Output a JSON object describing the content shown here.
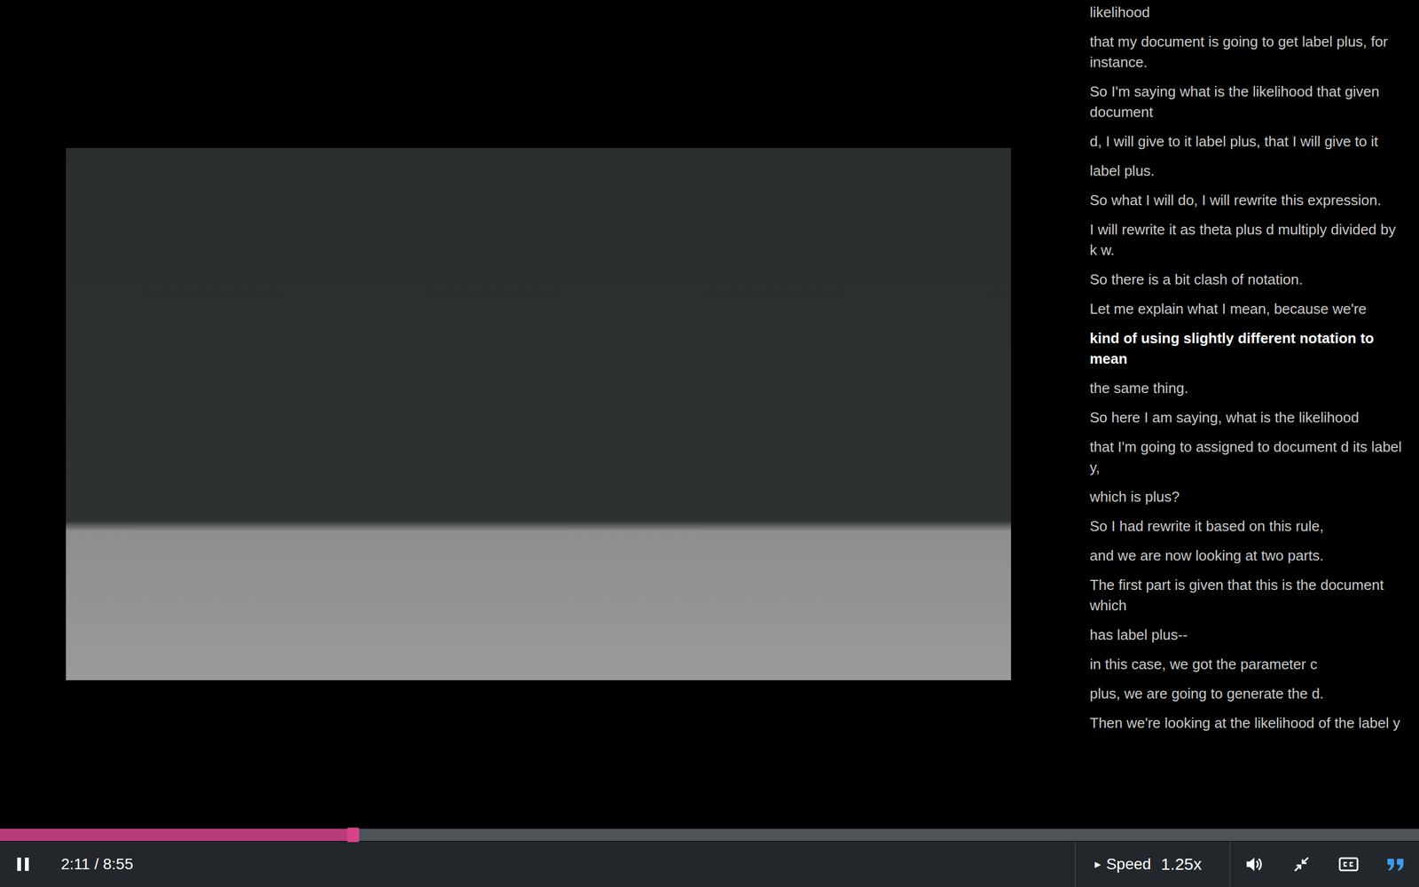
{
  "player": {
    "playing": true,
    "transcript_open": true
  },
  "transcript": [
    {
      "text": "likelihood",
      "selected": false
    },
    {
      "text": "that my document is going to get label plus, for instance.",
      "selected": false
    },
    {
      "text": "So I'm saying what is the likelihood that given document",
      "selected": false
    },
    {
      "text": "d, I will give to it label plus, that I will give to it",
      "selected": false
    },
    {
      "text": "label plus.",
      "selected": false
    },
    {
      "text": "So what I will do, I will rewrite this expression.",
      "selected": false
    },
    {
      "text": "I will rewrite it as theta plus d multiply divided by k w.",
      "selected": false
    },
    {
      "text": "So there is a bit clash of notation.",
      "selected": false
    },
    {
      "text": "Let me explain what I mean, because we're",
      "selected": false
    },
    {
      "text": "kind of using slightly different notation to mean",
      "selected": true
    },
    {
      "text": "the same thing.",
      "selected": false
    },
    {
      "text": "So here I am saying, what is the likelihood",
      "selected": false
    },
    {
      "text": "that I'm going to assigned to document d its label y,",
      "selected": false
    },
    {
      "text": "which is plus?",
      "selected": false
    },
    {
      "text": "So I had rewrite it based on this rule,",
      "selected": false
    },
    {
      "text": "and we are now looking at two parts.",
      "selected": false
    },
    {
      "text": "The first part is given that this is the document which",
      "selected": false
    },
    {
      "text": "has label plus--",
      "selected": false
    },
    {
      "text": "in this case, we got the parameter c",
      "selected": false
    },
    {
      "text": "plus, we are going to generate the d.",
      "selected": false
    },
    {
      "text": "Then we're looking at the likelihood of the label y",
      "selected": false
    }
  ],
  "progress": {
    "level": 0.247
  },
  "controls": {
    "time": "2:11 / 8:55",
    "speed_arrow": "▸",
    "speed_label": "Speed",
    "speed_value": "1.25x"
  }
}
